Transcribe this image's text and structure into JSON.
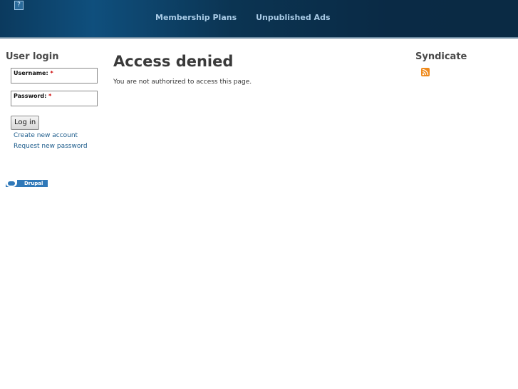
{
  "header": {
    "logo_glyph": "?",
    "nav": [
      {
        "label": "Membership Plans"
      },
      {
        "label": "Unpublished Ads"
      }
    ],
    "colors": {
      "bg": "#0b3452",
      "nav_text": "#a9cbe6"
    }
  },
  "sidebar_left": {
    "title": "User login",
    "username_label": "Username:",
    "password_label": "Password:",
    "required_mark": "*",
    "login_button": "Log in",
    "links": [
      {
        "label": "Create new account"
      },
      {
        "label": "Request new password"
      }
    ]
  },
  "main": {
    "title": "Access denied",
    "message": "You are not authorized to access this page."
  },
  "sidebar_right": {
    "title": "Syndicate",
    "icon": "rss-feed-icon"
  },
  "footer": {
    "badge_text": "Drupal",
    "badge_icon": "drupal-drop-icon"
  }
}
